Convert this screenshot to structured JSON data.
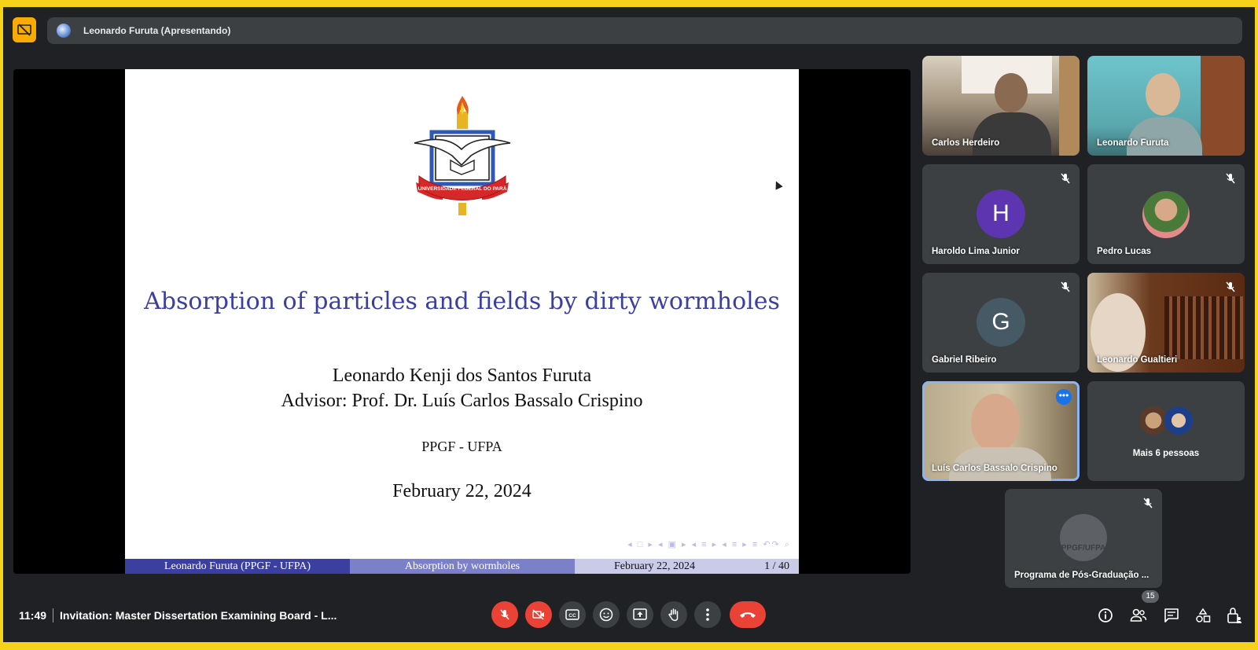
{
  "top": {
    "presenter_label": "Leonardo Furuta (Apresentando)"
  },
  "slide": {
    "title": "Absorption of particles and fields by dirty wormholes",
    "author": "Leonardo Kenji dos Santos Furuta",
    "advisor": "Advisor: Prof. Dr. Luís Carlos Bassalo Crispino",
    "institution": "PPGF - UFPA",
    "date": "February 22, 2024",
    "logo_text": "UNIVERSIDADE FEDERAL DO PARÁ",
    "footer": {
      "left": "Leonardo Furuta  (PPGF - UFPA)",
      "center": "Absorption by wormholes",
      "date": "February 22, 2024",
      "page": "1 / 40"
    }
  },
  "participants": [
    {
      "name": "Carlos Herdeiro",
      "type": "video",
      "muted": false
    },
    {
      "name": "Leonardo Furuta",
      "type": "video",
      "muted": false
    },
    {
      "name": "Haroldo Lima Junior",
      "type": "letter",
      "letter": "H",
      "color": "#5e35b1",
      "muted": true
    },
    {
      "name": "Pedro Lucas",
      "type": "photo",
      "muted": true
    },
    {
      "name": "Gabriel Ribeiro",
      "type": "letter",
      "letter": "G",
      "color": "#455a64",
      "muted": true
    },
    {
      "name": "Leonardo Gualtieri",
      "type": "video",
      "muted": true
    },
    {
      "name": "Luís Carlos Bassalo Crispino",
      "type": "video",
      "muted": false,
      "active": true
    },
    {
      "name": "Mais 6 pessoas",
      "type": "more"
    },
    {
      "name": "Programa de Pós-Graduação ...",
      "type": "logo",
      "logo_text": "PPGF/UFPA",
      "muted": true
    }
  ],
  "bottom": {
    "time": "11:49",
    "meeting_title": "Invitation: Master Dissertation Examining Board - L...",
    "participant_count": "15",
    "controls": [
      "mic-off",
      "camera-off",
      "captions",
      "emoji",
      "present",
      "raise-hand",
      "more-options",
      "leave-call"
    ],
    "right_controls": [
      "info",
      "people",
      "chat",
      "activities",
      "host-controls"
    ]
  }
}
